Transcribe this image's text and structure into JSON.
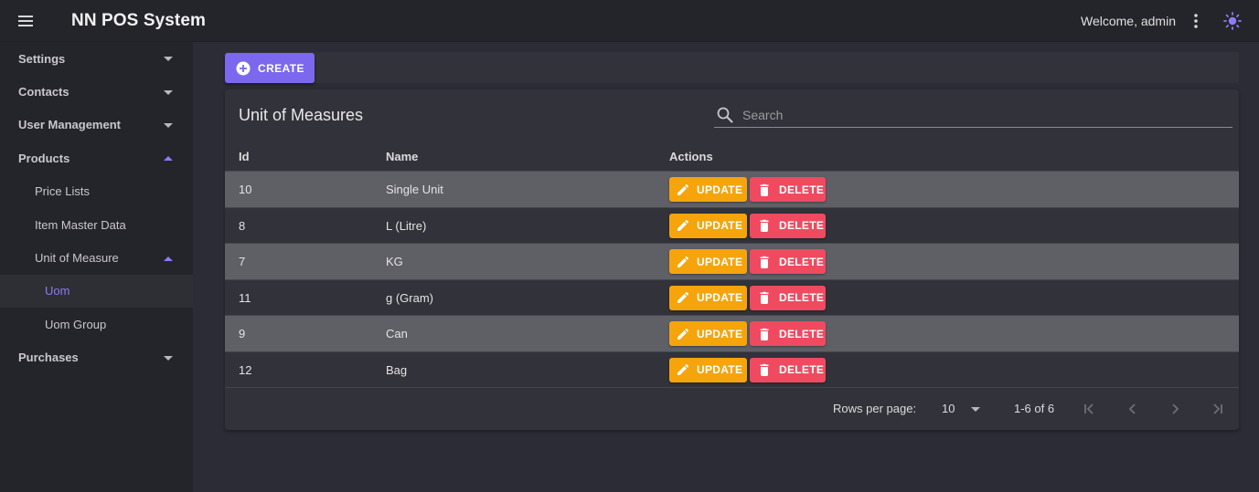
{
  "appbar": {
    "title": "NN POS System",
    "welcome": "Welcome, admin",
    "accent_color": "#7b68ee"
  },
  "sidebar": {
    "items": [
      {
        "label": "Settings"
      },
      {
        "label": "Contacts"
      },
      {
        "label": "User Management"
      },
      {
        "label": "Products"
      },
      {
        "label": "Price Lists"
      },
      {
        "label": "Item Master Data"
      },
      {
        "label": "Unit of Measure"
      },
      {
        "label": "Uom"
      },
      {
        "label": "Uom Group"
      },
      {
        "label": "Purchases"
      }
    ]
  },
  "toolbar": {
    "create_label": "CREATE"
  },
  "card": {
    "title": "Unit of Measures",
    "search_placeholder": "Search",
    "columns": [
      "Id",
      "Name",
      "Actions"
    ],
    "rows": [
      {
        "id": "10",
        "name": "Single Unit"
      },
      {
        "id": "8",
        "name": "L (Litre)"
      },
      {
        "id": "7",
        "name": "KG"
      },
      {
        "id": "11",
        "name": "g (Gram)"
      },
      {
        "id": "9",
        "name": "Can"
      },
      {
        "id": "12",
        "name": "Bag"
      }
    ],
    "update_label": "UPDATE",
    "delete_label": "DELETE",
    "update_color": "#f5a40c",
    "delete_color": "#ef4a60"
  },
  "pagination": {
    "rows_per_page_label": "Rows per page:",
    "rows_per_page_value": "10",
    "range": "1-6 of 6"
  }
}
